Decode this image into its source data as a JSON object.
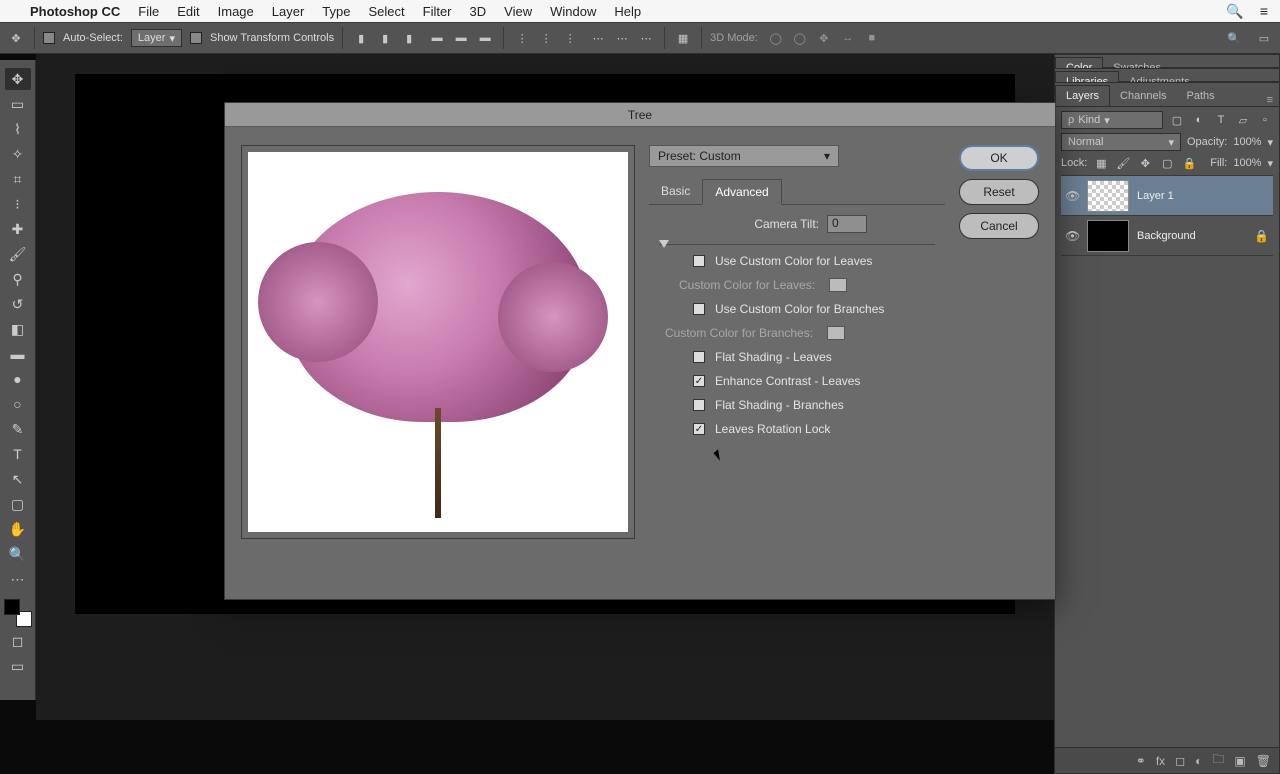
{
  "menubar": {
    "app": "Photoshop CC",
    "items": [
      "File",
      "Edit",
      "Image",
      "Layer",
      "Type",
      "Select",
      "Filter",
      "3D",
      "View",
      "Window",
      "Help"
    ]
  },
  "optbar": {
    "auto_select": "Auto-Select:",
    "auto_select_value": "Layer",
    "show_transform": "Show Transform Controls",
    "mode3d": "3D Mode:"
  },
  "dialog": {
    "title": "Tree",
    "preset_label": "Preset: Custom",
    "tabs": {
      "basic": "Basic",
      "advanced": "Advanced"
    },
    "camera_tilt_label": "Camera Tilt:",
    "camera_tilt_value": "0",
    "use_custom_leaves": "Use Custom Color for Leaves",
    "custom_leaves_label": "Custom Color for Leaves:",
    "use_custom_branches": "Use Custom Color for Branches",
    "custom_branches_label": "Custom Color for Branches:",
    "flat_leaves": "Flat Shading - Leaves",
    "enhance_contrast": "Enhance Contrast - Leaves",
    "flat_branches": "Flat Shading - Branches",
    "leaves_rotation": "Leaves Rotation Lock",
    "buttons": {
      "ok": "OK",
      "reset": "Reset",
      "cancel": "Cancel"
    }
  },
  "panels": {
    "color": "Color",
    "swatches": "Swatches",
    "libraries": "Libraries",
    "adjustments": "Adjustments",
    "layers": "Layers",
    "channels": "Channels",
    "paths": "Paths",
    "kind": "Kind",
    "blend": "Normal",
    "opacity_label": "Opacity:",
    "opacity": "100%",
    "lock_label": "Lock:",
    "fill_label": "Fill:",
    "fill": "100%",
    "layer1": "Layer 1",
    "background": "Background"
  }
}
